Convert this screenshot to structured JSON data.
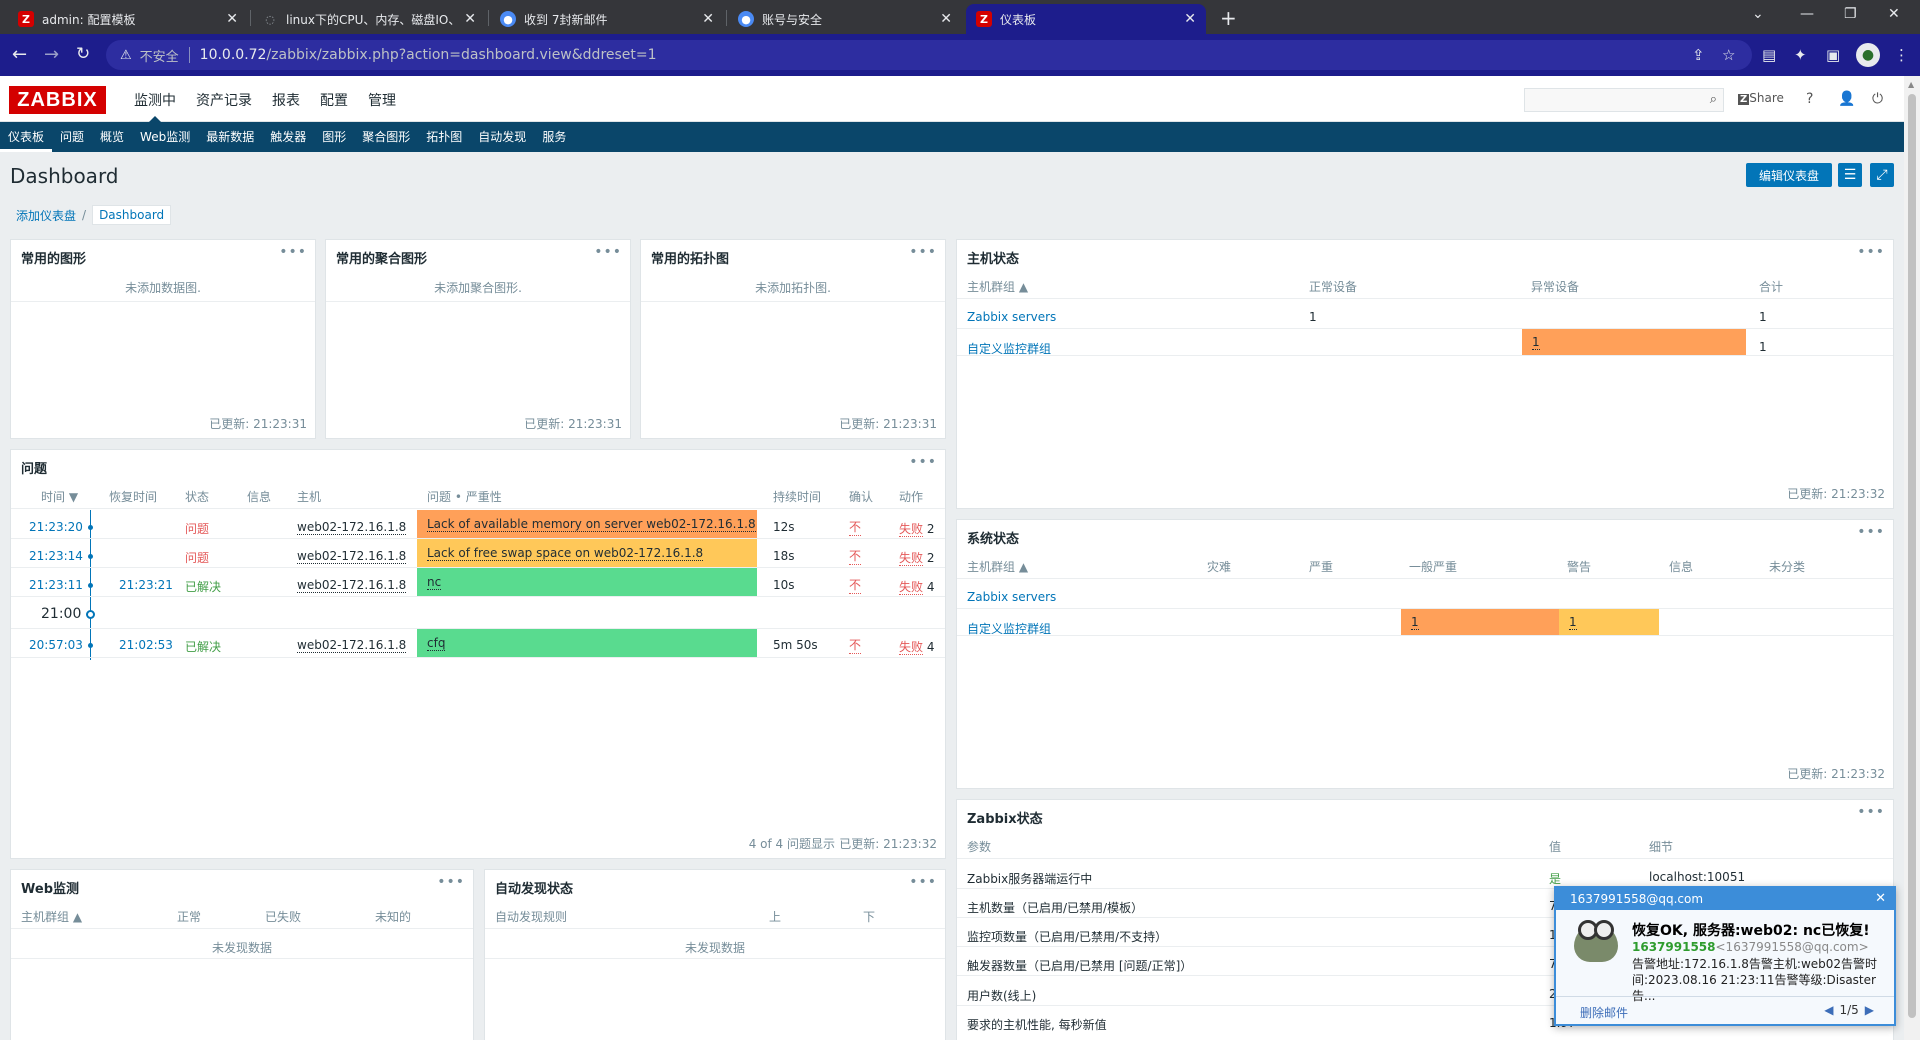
{
  "browser": {
    "tabs": [
      {
        "label": "admin: 配置模板",
        "icon": "zabbix-icon",
        "active": false
      },
      {
        "label": "linux下的CPU、内存、磁盘IO、",
        "icon": "loading-icon",
        "active": false
      },
      {
        "label": "收到 7封新邮件",
        "icon": "chrome-icon",
        "active": false
      },
      {
        "label": "账号与安全",
        "icon": "chrome-icon",
        "active": false
      },
      {
        "label": "仪表板",
        "icon": "zabbix-icon",
        "active": true
      }
    ],
    "address": {
      "insecure": "不安全",
      "host": "10.0.0.72",
      "path": "/zabbix/zabbix.php?action=dashboard.view&ddreset=1"
    }
  },
  "zabbix": {
    "logo": "ZABBIX",
    "top_menu": [
      "监测中",
      "资产记录",
      "报表",
      "配置",
      "管理"
    ],
    "share": "Share",
    "sub_menu": [
      "仪表板",
      "问题",
      "概览",
      "Web监测",
      "最新数据",
      "触发器",
      "图形",
      "聚合图形",
      "拓扑图",
      "自动发现",
      "服务"
    ]
  },
  "page": {
    "title": "Dashboard",
    "edit_button": "编辑仪表盘",
    "breadcrumb": {
      "root": "添加仪表盘",
      "current": "Dashboard"
    }
  },
  "widgets": {
    "fav_graphs": {
      "title": "常用的图形",
      "empty": "未添加数据图.",
      "updated": "已更新: 21:23:31"
    },
    "fav_screens": {
      "title": "常用的聚合图形",
      "empty": "未添加聚合图形.",
      "updated": "已更新: 21:23:31"
    },
    "fav_maps": {
      "title": "常用的拓扑图",
      "empty": "未添加拓扑图.",
      "updated": "已更新: 21:23:31"
    },
    "host_status": {
      "title": "主机状态",
      "headers": [
        "主机群组 ▲",
        "正常设备",
        "异常设备",
        "合计"
      ],
      "rows": [
        {
          "group": "Zabbix servers",
          "ok": "1",
          "problem": "",
          "total": "1"
        },
        {
          "group": "自定义监控群组",
          "ok": "",
          "problem": "1",
          "total": "1"
        }
      ],
      "updated": "已更新: 21:23:32"
    },
    "problems": {
      "title": "问题",
      "headers": [
        "时间 ▼",
        "恢复时间",
        "状态",
        "信息",
        "主机",
        "问题 • 严重性",
        "持续时间",
        "确认",
        "动作"
      ],
      "rows": [
        {
          "time": "21:23:20",
          "recovery": "",
          "status": "问题",
          "host": "web02-172.16.1.8",
          "problem": "Lack of available memory on server web02-172.16.1.8",
          "severity": "average",
          "duration": "12s",
          "ack": "不",
          "action": "失败",
          "action_count": "2"
        },
        {
          "time": "21:23:14",
          "recovery": "",
          "status": "问题",
          "host": "web02-172.16.1.8",
          "problem": "Lack of free swap space on web02-172.16.1.8",
          "severity": "warning",
          "duration": "18s",
          "ack": "不",
          "action": "失败",
          "action_count": "2"
        },
        {
          "time": "21:23:11",
          "recovery": "21:23:21",
          "status": "已解决",
          "host": "web02-172.16.1.8",
          "problem": "nc",
          "severity": "resolved",
          "duration": "10s",
          "ack": "不",
          "action": "失败",
          "action_count": "4"
        },
        {
          "time": "20:57:03",
          "recovery": "21:02:53",
          "status": "已解决",
          "host": "web02-172.16.1.8",
          "problem": "cfq",
          "severity": "resolved",
          "duration": "5m 50s",
          "ack": "不",
          "action": "失败",
          "action_count": "4"
        }
      ],
      "hour_marker": "21:00",
      "footer_count": "4 of 4 问题显示",
      "updated": "已更新: 21:23:32"
    },
    "system_status": {
      "title": "系统状态",
      "headers": [
        "主机群组 ▲",
        "灾难",
        "严重",
        "一般严重",
        "警告",
        "信息",
        "未分类"
      ],
      "rows": [
        {
          "group": "Zabbix servers",
          "average": "",
          "warning": ""
        },
        {
          "group": "自定义监控群组",
          "average": "1",
          "warning": "1"
        }
      ],
      "updated": "已更新: 21:23:32"
    },
    "zabbix_status": {
      "title": "Zabbix状态",
      "headers": [
        "参数",
        "值",
        "细节"
      ],
      "rows": [
        {
          "param": "Zabbix服务器端运行中",
          "value": "是",
          "detail": "localhost:10051"
        },
        {
          "param": "主机数量（已启用/已禁用/模板）",
          "value": "7",
          "detail": ""
        },
        {
          "param": "监控项数量（已启用/已禁用/不支持）",
          "value": "1",
          "detail": ""
        },
        {
          "param": "触发器数量（已启用/已禁用 [问题/正常]）",
          "value": "7",
          "detail": ""
        },
        {
          "param": "用户数(线上)",
          "value": "2",
          "detail": ""
        },
        {
          "param": "要求的主机性能, 每秒新值",
          "value": "1.97",
          "detail": ""
        }
      ]
    },
    "web_monitor": {
      "title": "Web监测",
      "headers": [
        "主机群组 ▲",
        "正常",
        "已失败",
        "未知的"
      ],
      "empty": "未发现数据"
    },
    "discovery": {
      "title": "自动发现状态",
      "headers": [
        "自动发现规则",
        "上",
        "下"
      ],
      "empty": "未发现数据"
    }
  },
  "notification": {
    "account": "1637991558@qq.com",
    "subject": "恢复OK, 服务器:web02: nc已恢复!",
    "from_name": "1637991558",
    "from_addr": "<1637991558@qq.com>",
    "body": "告警地址:172.16.1.8告警主机:web02告警时间:2023.08.16 21:23:11告警等级:Disaster告...",
    "delete": "删除邮件",
    "pager": "1/5"
  },
  "colors": {
    "average": "#ffa059",
    "warning": "#ffc859",
    "resolved": "#59db8f",
    "link": "#0275b8",
    "nav": "#0a466a"
  }
}
